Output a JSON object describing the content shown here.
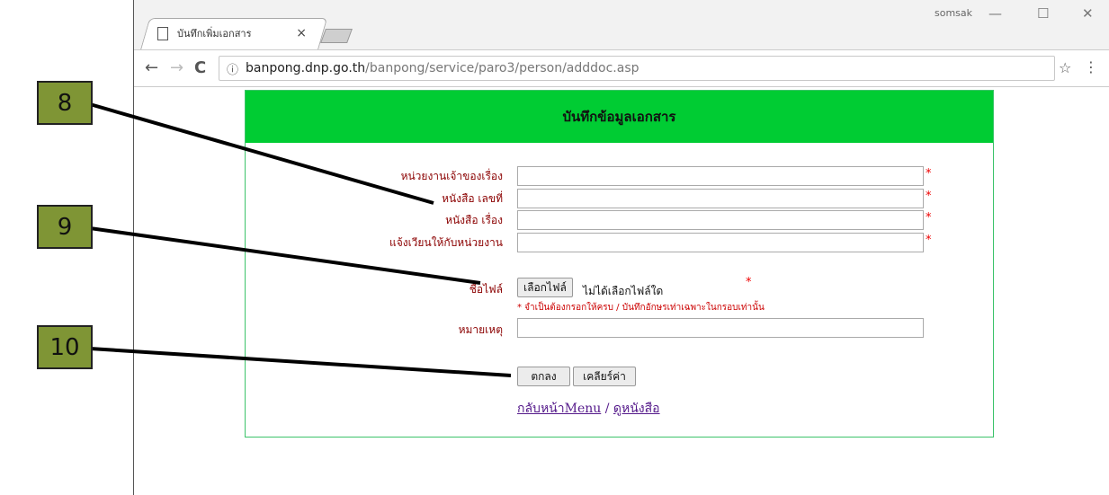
{
  "browser": {
    "tab_title": "บันทึกเพิ่มเอกสาร",
    "tab_close": "×",
    "user": "somsak",
    "window_controls": {
      "minimize": "—",
      "maximize": "☐",
      "close": "✕"
    },
    "nav": {
      "back": "←",
      "forward": "→",
      "reload": "C"
    },
    "info_icon": "ⓘ",
    "url_host": "banpong.dnp.go.th",
    "url_path": "/banpong/service/paro3/person/adddoc.asp",
    "star": "☆",
    "menu": "⋮"
  },
  "form": {
    "title": "บันทึกข้อมูลเอกสาร",
    "fields": [
      {
        "label": "หน่วยงานเจ้าของเรื่อง",
        "value": "",
        "required": "*"
      },
      {
        "label": "หนังสือ เลขที่",
        "value": "",
        "required": "*"
      },
      {
        "label": "หนังสือ เรื่อง",
        "value": "",
        "required": "*"
      },
      {
        "label": "แจ้งเวียนให้กับหน่วยงาน",
        "value": "",
        "required": "*"
      }
    ],
    "file": {
      "label": "ชื่อไฟล์",
      "button": "เลือกไฟล์",
      "status": "ไม่ได้เลือกไฟล์ใด",
      "required": "*"
    },
    "note": "* จำเป็นต้องกรอกให้ครบ / บันทึกอักษรเท่าเฉพาะในกรอบเท่านั้น",
    "remark": {
      "label": "หมายเหตุ",
      "value": ""
    },
    "submit": "ตกลง",
    "clear": "เคลียร์ค่า",
    "link_menu": "กลับหน้าMenu",
    "link_sep": "/",
    "link_books": "ดูหนังสือ"
  },
  "callouts": [
    "8",
    "9",
    "10"
  ],
  "colors": {
    "header_green": "#00cc33",
    "label_red": "#8b0000",
    "callout_olive": "#7f9535"
  }
}
